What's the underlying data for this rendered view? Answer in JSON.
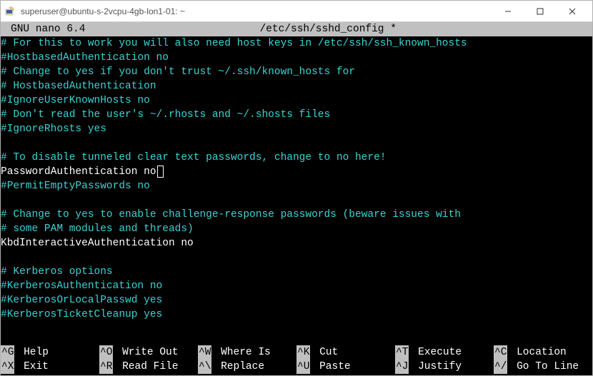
{
  "window": {
    "title": "superuser@ubuntu-s-2vcpu-4gb-lon1-01: ~"
  },
  "header": {
    "app": "GNU nano 6.4",
    "file": "/etc/ssh/sshd_config *"
  },
  "lines": [
    {
      "cls": "cyan",
      "text": "# For this to work you will also need host keys in /etc/ssh/ssh_known_hosts"
    },
    {
      "cls": "cyan",
      "text": "#HostbasedAuthentication no"
    },
    {
      "cls": "cyan",
      "text": "# Change to yes if you don't trust ~/.ssh/known_hosts for"
    },
    {
      "cls": "cyan",
      "text": "# HostbasedAuthentication"
    },
    {
      "cls": "cyan",
      "text": "#IgnoreUserKnownHosts no"
    },
    {
      "cls": "cyan",
      "text": "# Don't read the user's ~/.rhosts and ~/.shosts files"
    },
    {
      "cls": "cyan",
      "text": "#IgnoreRhosts yes"
    },
    {
      "cls": "",
      "text": ""
    },
    {
      "cls": "cyan",
      "text": "# To disable tunneled clear text passwords, change to no here!"
    },
    {
      "cls": "white",
      "text": "PasswordAuthentication no",
      "cursor": true
    },
    {
      "cls": "cyan",
      "text": "#PermitEmptyPasswords no"
    },
    {
      "cls": "",
      "text": ""
    },
    {
      "cls": "cyan",
      "text": "# Change to yes to enable challenge-response passwords (beware issues with"
    },
    {
      "cls": "cyan",
      "text": "# some PAM modules and threads)"
    },
    {
      "cls": "white",
      "text": "KbdInteractiveAuthentication no"
    },
    {
      "cls": "",
      "text": ""
    },
    {
      "cls": "cyan",
      "text": "# Kerberos options"
    },
    {
      "cls": "cyan",
      "text": "#KerberosAuthentication no"
    },
    {
      "cls": "cyan",
      "text": "#KerberosOrLocalPasswd yes"
    },
    {
      "cls": "cyan",
      "text": "#KerberosTicketCleanup yes"
    }
  ],
  "shortcuts": [
    {
      "key": "^G",
      "label": "Help"
    },
    {
      "key": "^O",
      "label": "Write Out"
    },
    {
      "key": "^W",
      "label": "Where Is"
    },
    {
      "key": "^K",
      "label": "Cut"
    },
    {
      "key": "^T",
      "label": "Execute"
    },
    {
      "key": "^C",
      "label": "Location"
    },
    {
      "key": "^X",
      "label": "Exit"
    },
    {
      "key": "^R",
      "label": "Read File"
    },
    {
      "key": "^\\",
      "label": "Replace"
    },
    {
      "key": "^U",
      "label": "Paste"
    },
    {
      "key": "^J",
      "label": "Justify"
    },
    {
      "key": "^/",
      "label": "Go To Line"
    }
  ]
}
